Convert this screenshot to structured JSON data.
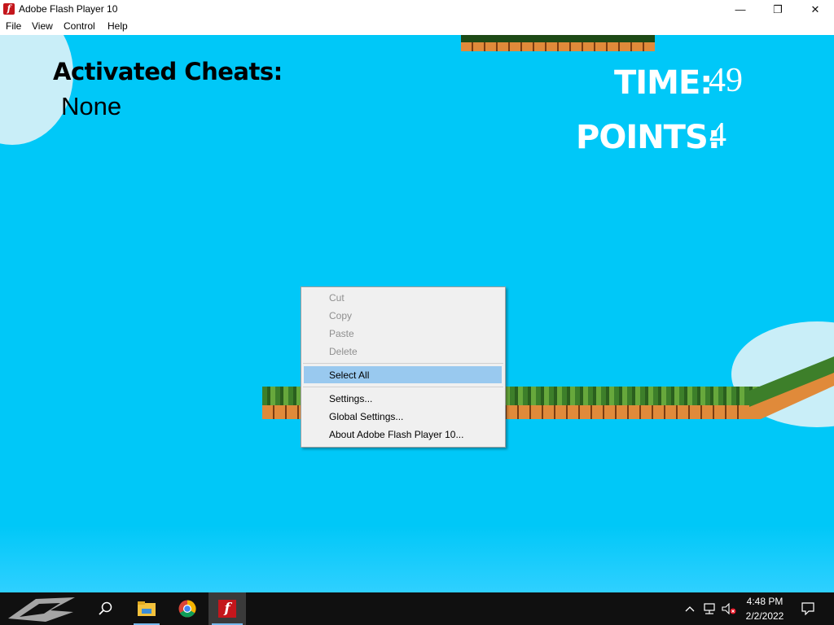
{
  "window": {
    "title": "Adobe Flash Player 10",
    "app_icon_glyph": "f",
    "minimize_glyph": "—",
    "maximize_glyph": "❐",
    "close_glyph": "✕"
  },
  "menubar": {
    "items": [
      {
        "label": "File"
      },
      {
        "label": "View"
      },
      {
        "label": "Control"
      },
      {
        "label": "Help"
      }
    ]
  },
  "game": {
    "cheats_title": "Activated Cheats:",
    "cheats_value": "None",
    "time_label": "TIME:",
    "time_value": "49",
    "points_label": "POINTS:",
    "points_value": "4",
    "colors": {
      "sky": "#00c8f8",
      "cloud": "#c9eef8"
    }
  },
  "context_menu": {
    "items": [
      {
        "label": "Cut",
        "enabled": false
      },
      {
        "label": "Copy",
        "enabled": false
      },
      {
        "label": "Paste",
        "enabled": false
      },
      {
        "label": "Delete",
        "enabled": false
      },
      {
        "label": "Select All",
        "enabled": true,
        "highlighted": true
      },
      {
        "label": "Settings...",
        "enabled": true
      },
      {
        "label": "Global Settings...",
        "enabled": true
      },
      {
        "label": "About Adobe Flash Player 10...",
        "enabled": true
      }
    ],
    "highlight_color": "#99c9ef"
  },
  "taskbar": {
    "icons": [
      "rog-logo-icon",
      "search-icon",
      "file-explorer-icon",
      "chrome-icon",
      "flash-player-icon"
    ],
    "tray": {
      "time": "4:48 PM",
      "date": "2/2/2022",
      "icons": [
        "chevron-up-icon",
        "network-icon",
        "volume-muted-icon",
        "notification-icon"
      ]
    }
  }
}
